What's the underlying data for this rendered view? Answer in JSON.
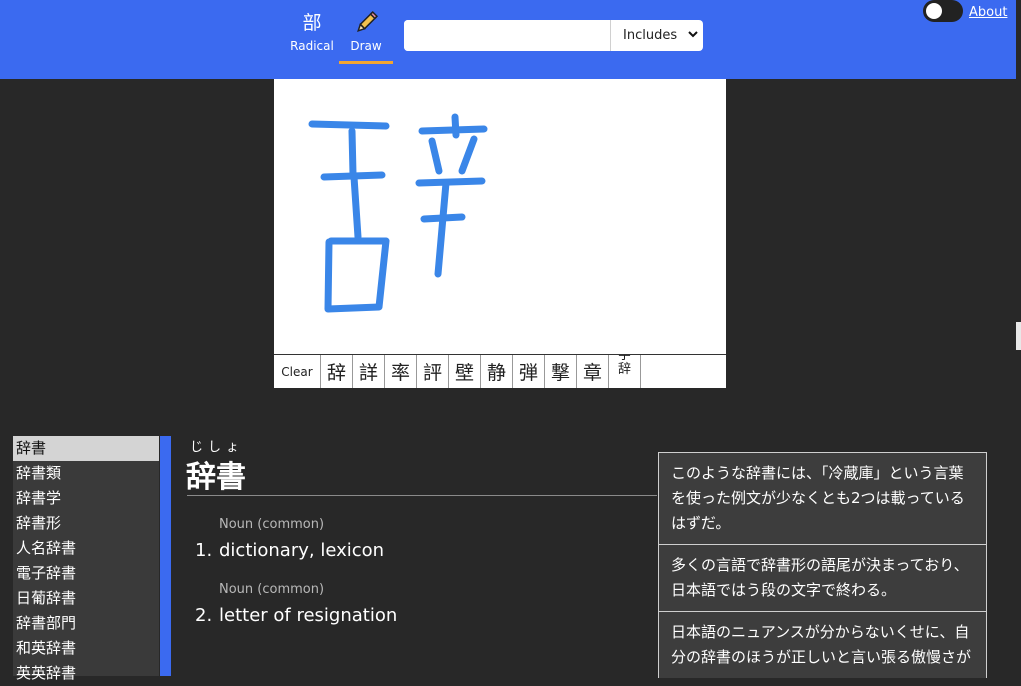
{
  "header": {
    "modes": [
      {
        "glyph": "部",
        "label": "Radical"
      },
      {
        "glyph": "",
        "label": "Draw"
      }
    ],
    "search": {
      "value": "",
      "placeholder": "",
      "match_mode": "Includes"
    },
    "about_label": "About",
    "accent": "#3b6af0",
    "active_underline": "#f2a531"
  },
  "candidates": {
    "clear_label": "Clear",
    "kanji": [
      "辞",
      "詳",
      "率",
      "評",
      "壁",
      "静",
      "弾",
      "撃",
      "章"
    ],
    "partial": [
      "字",
      "辞"
    ]
  },
  "results": {
    "items": [
      "辞書",
      "辞書類",
      "辞書学",
      "辞書形",
      "人名辞書",
      "電子辞書",
      "日葡辞書",
      "辞書部門",
      "和英辞書",
      "英英辞書"
    ],
    "selected": "辞書"
  },
  "entry": {
    "reading": "じしょ",
    "word": "辞書",
    "senses": [
      {
        "pos": "Noun (common)",
        "num": "1.",
        "gloss": "dictionary, lexicon"
      },
      {
        "pos": "Noun (common)",
        "num": "2.",
        "gloss": "letter of resignation"
      }
    ]
  },
  "examples": [
    "このような辞書には、「冷蔵庫」という言葉を使った例文が少なくとも2つは載っているはずだ。",
    "多くの言語で辞書形の語尾が決まっており、日本語ではう段の文字で終わる。",
    "日本語のニュアンスが分からないくせに、自分の辞書のほうが正しいと言い張る傲慢さが"
  ],
  "stroke_color": "#3a86e8"
}
